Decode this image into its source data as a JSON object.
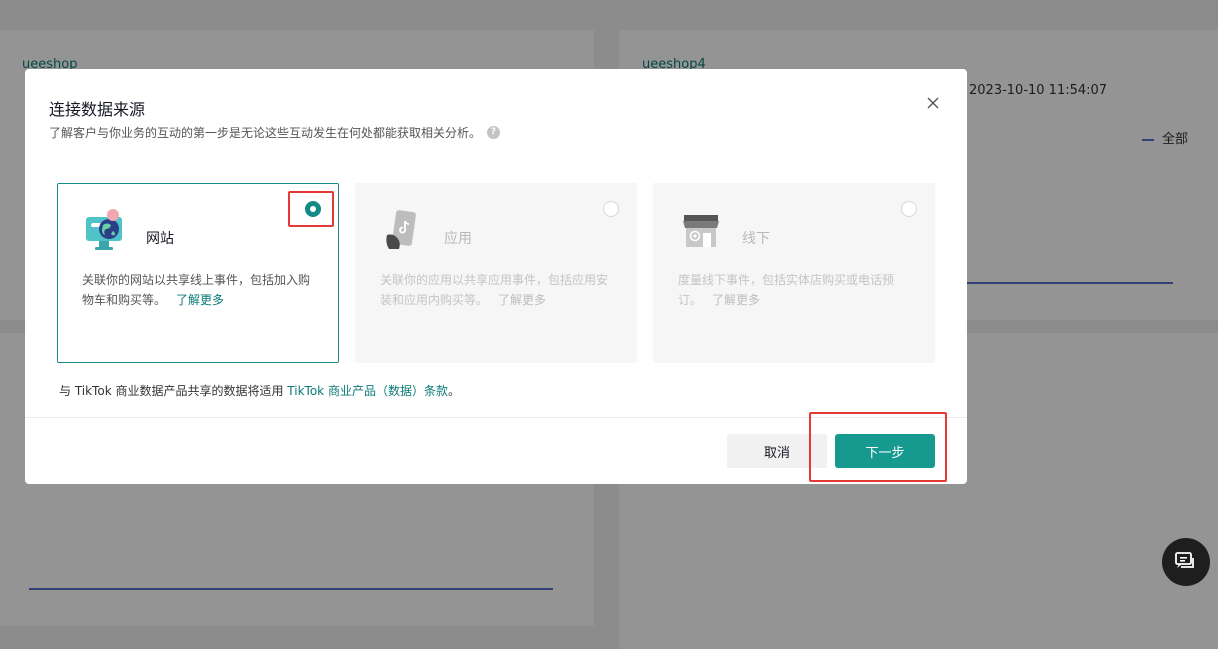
{
  "background": {
    "card_a_title": "ueeshop",
    "card_b_title": "ueeshop4",
    "card_b_timestamp": "2023-10-10 11:54:07",
    "legend_all": "全部"
  },
  "modal": {
    "title": "连接数据来源",
    "subtitle": "了解客户与你业务的互动的第一步是无论这些互动发生在何处都能获取相关分析。",
    "options": [
      {
        "name": "网站",
        "desc": "关联你的网站以共享线上事件，包括加入购物车和购买等。",
        "link": "了解更多",
        "selected": true,
        "icon": "website-globe-icon"
      },
      {
        "name": "应用",
        "desc": "关联你的应用以共享应用事件，包括应用安装和应用内购买等。",
        "link": "了解更多",
        "selected": false,
        "icon": "app-phone-icon"
      },
      {
        "name": "线下",
        "desc": "度量线下事件，包括实体店购买或电话预订。",
        "link": "了解更多",
        "selected": false,
        "icon": "offline-store-icon"
      }
    ],
    "footnote_prefix": "与 TikTok 商业数据产品共享的数据将适用",
    "footnote_link": "TikTok 商业产品（数据）条款",
    "footnote_suffix": "。",
    "cancel_label": "取消",
    "next_label": "下一步"
  },
  "colors": {
    "accent": "#169a90",
    "link": "#0a7a78",
    "highlight": "#e53935"
  }
}
